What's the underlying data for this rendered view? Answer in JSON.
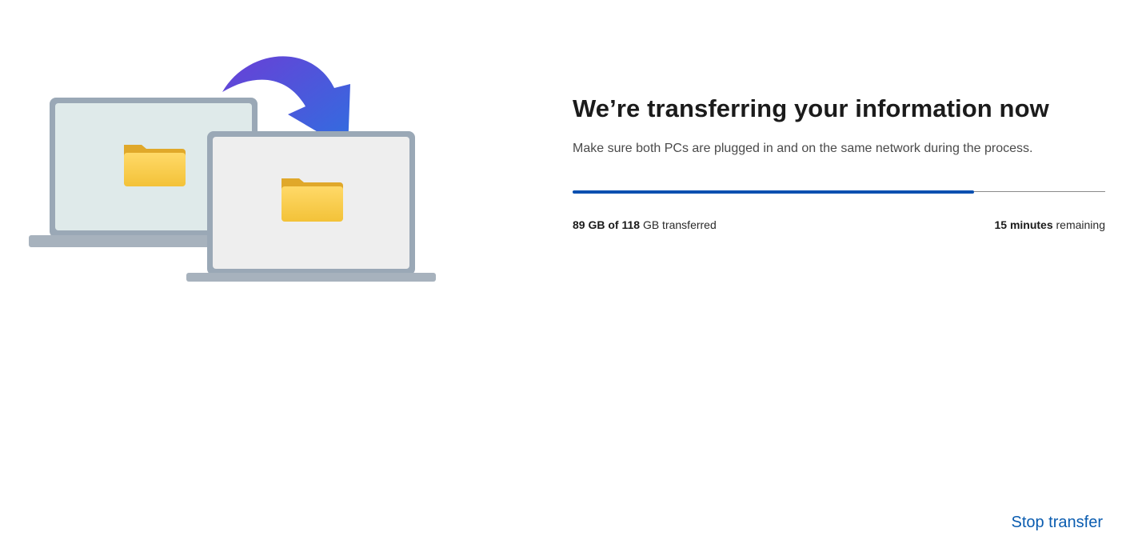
{
  "illustration": {
    "source_pc_icon": "laptop-icon",
    "target_pc_icon": "laptop-icon",
    "folder_icon": "folder-icon",
    "arrow_icon": "curved-arrow-icon",
    "colors": {
      "laptop_frame": "#9aa8b6",
      "laptop_base": "#a7b2bd",
      "source_screen": "#dfeaea",
      "target_screen": "#eeeeee",
      "folder": "#f5c842",
      "arrow_start": "#6a3fd6",
      "arrow_end": "#2f6fe0"
    }
  },
  "header": {
    "title": "We’re transferring your information now",
    "subtitle": "Make sure both PCs are plugged in and on the same network during the process."
  },
  "progress": {
    "fraction": 0.7542,
    "accent_color": "#0a50b0",
    "transferred_amount": "89 GB of 118",
    "transferred_suffix": "GB transferred",
    "remaining_amount": "15 minutes",
    "remaining_suffix": "remaining"
  },
  "actions": {
    "stop_label": "Stop transfer"
  }
}
